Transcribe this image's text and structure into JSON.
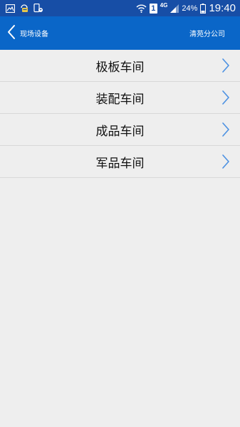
{
  "status_bar": {
    "icons": [
      "image-icon",
      "voicemail-icon",
      "phone-message-icon"
    ],
    "sim_slot": "1",
    "network_type": "4G",
    "battery": "24%",
    "time": "19:40"
  },
  "header": {
    "back_icon": "chevron-left-icon",
    "title": "现场设备",
    "company": "清苑分公司"
  },
  "workshops": [
    {
      "label": "极板车间",
      "icon": "chevron-right-icon"
    },
    {
      "label": "装配车间",
      "icon": "chevron-right-icon"
    },
    {
      "label": "成品车间",
      "icon": "chevron-right-icon"
    },
    {
      "label": "军品车间",
      "icon": "chevron-right-icon"
    }
  ],
  "colors": {
    "status_bar": "#174ea6",
    "app_bar": "#0a66c8",
    "background": "#eeeeee",
    "chevron": "#4a90e2"
  }
}
